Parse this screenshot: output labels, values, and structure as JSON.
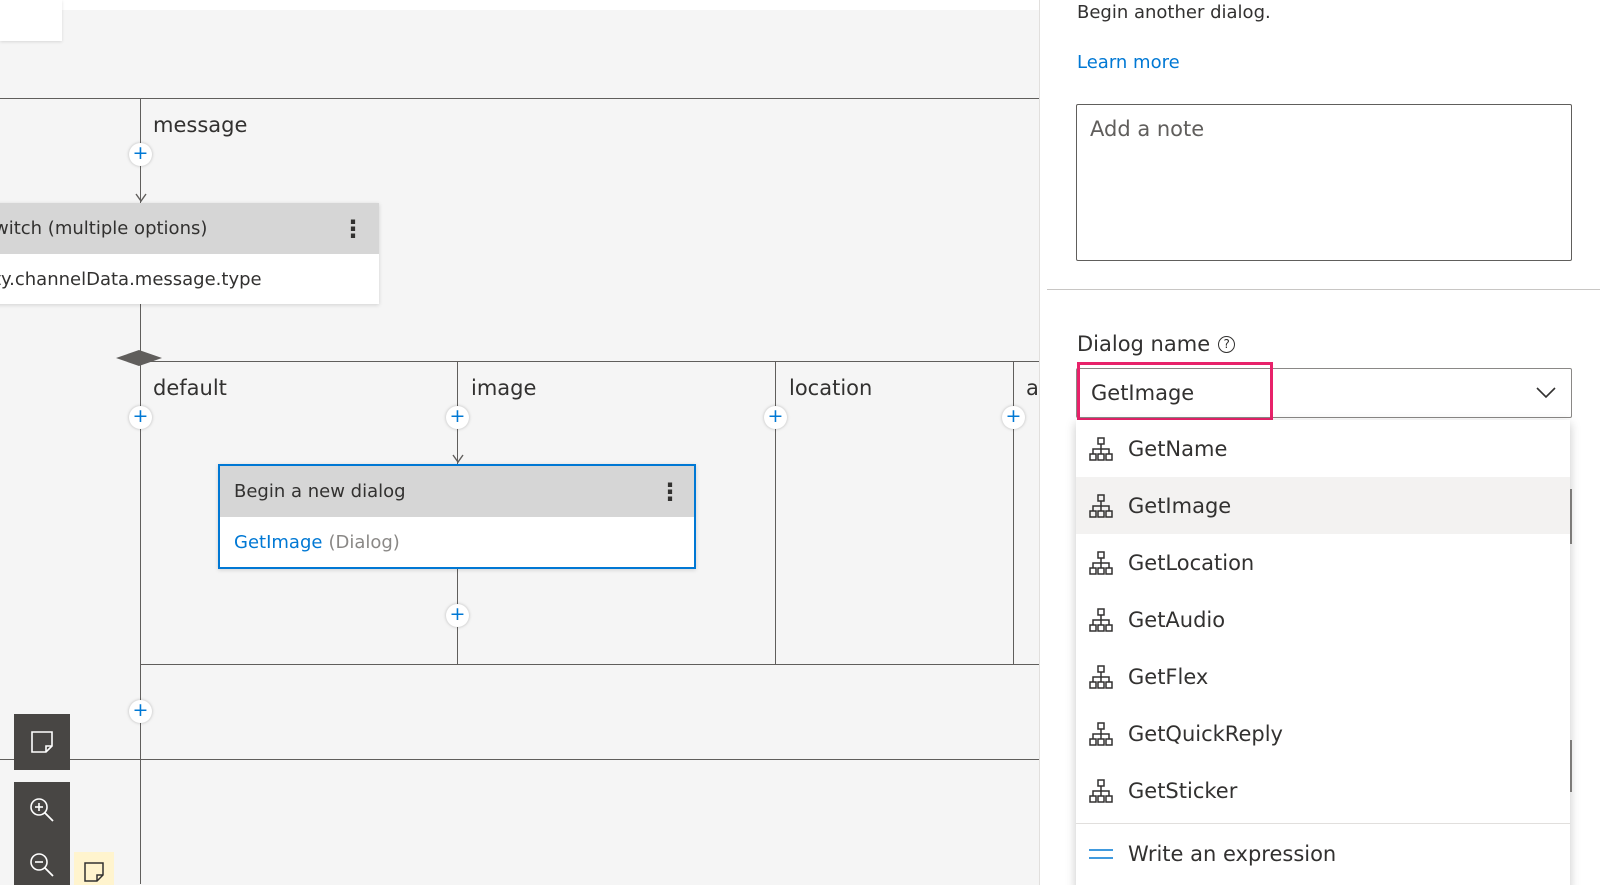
{
  "canvas": {
    "trigger_edge_label": "message",
    "switch_node": {
      "title": "witch (multiple options)",
      "condition": "ty.channelData.message.type"
    },
    "branches": [
      {
        "label": "default"
      },
      {
        "label": "image"
      },
      {
        "label": "location"
      },
      {
        "label": "a"
      }
    ],
    "dialog_node": {
      "title": "Begin a new dialog",
      "dialog_link": "GetImage",
      "dialog_type": "(Dialog)"
    },
    "toolbar_icons": [
      "add-comment-icon",
      "zoom-in-icon",
      "zoom-out-icon"
    ]
  },
  "panel": {
    "description": "Begin another dialog.",
    "learn_more": "Learn more",
    "note_placeholder": "Add a note",
    "dialog_name_label": "Dialog name",
    "selected_dialog": "GetImage",
    "options": [
      {
        "label": "GetName",
        "icon": "dialog-tree-icon"
      },
      {
        "label": "GetImage",
        "icon": "dialog-tree-icon",
        "selected": true
      },
      {
        "label": "GetLocation",
        "icon": "dialog-tree-icon"
      },
      {
        "label": "GetAudio",
        "icon": "dialog-tree-icon"
      },
      {
        "label": "GetFlex",
        "icon": "dialog-tree-icon"
      },
      {
        "label": "GetQuickReply",
        "icon": "dialog-tree-icon"
      },
      {
        "label": "GetSticker",
        "icon": "dialog-tree-icon"
      }
    ],
    "expression_option": "Write an expression"
  },
  "colors": {
    "accent": "#0078d4",
    "highlight": "#e8226a",
    "canvas_bg": "#f5f5f5",
    "node_header": "#d6d6d6"
  }
}
